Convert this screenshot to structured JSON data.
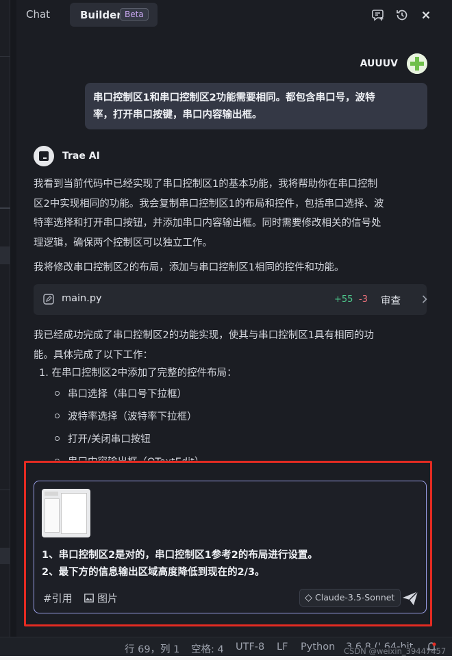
{
  "tabs": {
    "chat": "Chat",
    "builder": "Builder",
    "beta": "Beta"
  },
  "header_icons": [
    "new-chat-icon",
    "history-icon",
    "close-icon"
  ],
  "user": {
    "name": "AUUUV",
    "message_line1": "串口控制区1和串口控制区2功能需要相同。都包含串口号，波特",
    "message_line2": "率，打开串口按键，串口内容输出框。"
  },
  "ai": {
    "name": "Trae AI",
    "para1": [
      "我看到当前代码中已经实现了串口控制区1的基本功能，我将帮助你在串口控制",
      "区2中实现相同的功能。我会复制串口控制区1的布局和控件，包括串口选择、波",
      "特率选择和打开串口按钮，并添加串口内容输出框。同时需要修改相关的信号处",
      "理逻辑，确保两个控制区可以独立工作。"
    ],
    "para2": "我将修改串口控制区2的布局，添加与串口控制区1相同的控件和功能。",
    "file": {
      "name": "main.py",
      "additions": "+55",
      "deletions": "-3",
      "review": "审查"
    },
    "para3": [
      "我已经成功完成了串口控制区2的功能实现，使其与串口控制区1具有相同的功",
      "能。具体完成了以下工作："
    ],
    "list_item": "1. 在串口控制区2中添加了完整的控件布局：",
    "bullets": [
      "串口选择（串口号下拉框）",
      "波特率选择（波特率下拉框）",
      "打开/关闭串口按钮",
      "串口内容输出框（QTextEdit）"
    ]
  },
  "input": {
    "line1": "1、串口控制区2是对的，串口控制区1参考2的布局进行设置。",
    "line2": "2、最下方的信息输出区域高度降低到现在的2/3。",
    "cite": "#引用",
    "image": "图片",
    "model": "Claude-3.5-Sonnet"
  },
  "status": {
    "position": "行 69，列 1",
    "spaces": "空格: 4",
    "encoding": "UTF-8",
    "eol": "LF",
    "language": "Python",
    "version": "3.6.8 ('.64-bit",
    "watermark": "CSDN @weixin_39447457"
  },
  "colors": {
    "accent_border": "#9aa0e8",
    "annotation": "#e42b22",
    "added": "#4ec98d",
    "removed": "#e9707a"
  }
}
